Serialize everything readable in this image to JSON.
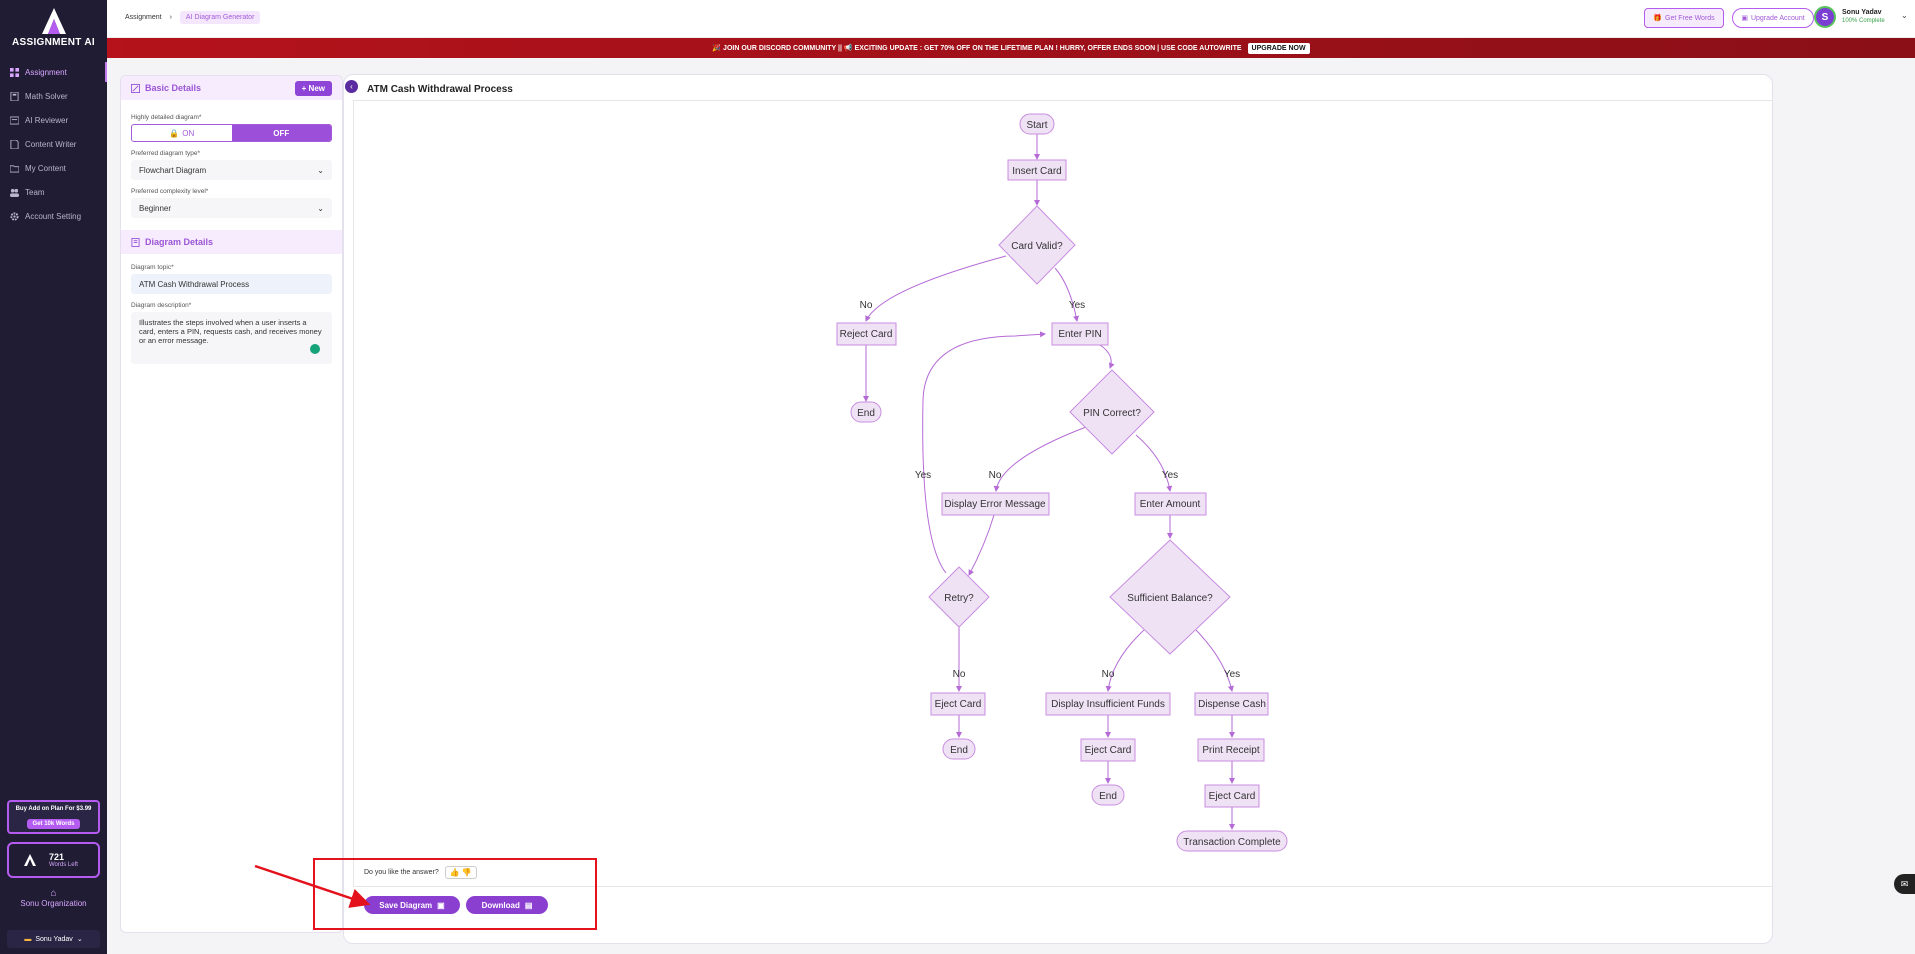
{
  "sidebar": {
    "logo_text": "ASSIGNMENT AI",
    "items": [
      {
        "label": "Assignment",
        "icon": "grid-icon",
        "active": true
      },
      {
        "label": "Math Solver",
        "icon": "calculator-icon",
        "active": false
      },
      {
        "label": "AI Reviewer",
        "icon": "review-icon",
        "active": false
      },
      {
        "label": "Content Writer",
        "icon": "document-icon",
        "active": false
      },
      {
        "label": "My Content",
        "icon": "folder-icon",
        "active": false
      },
      {
        "label": "Team",
        "icon": "team-icon",
        "active": false
      },
      {
        "label": "Account Setting",
        "icon": "gear-icon",
        "active": false
      }
    ],
    "promo_text": "Buy Add on Plan For $3.99",
    "promo_button": "Get 10k Words",
    "words_count": "721",
    "words_label": "Words Left",
    "org_name": "Sonu Organization",
    "footer_user": "Sonu Yadav"
  },
  "topbar": {
    "breadcrumb_root": "Assignment",
    "breadcrumb_current": "AI Diagram Generator",
    "free_words": "Get Free Words",
    "upgrade": "Upgrade Account",
    "avatar_letter": "S",
    "user_name": "Sonu Yadav",
    "user_status": "100% Complete"
  },
  "banner": {
    "text": "🎉 JOIN OUR DISCORD COMMUNITY || 📢 EXCITING UPDATE : GET 70% OFF ON THE LIFETIME PLAN ! HURRY, OFFER ENDS SOON | USE CODE AUTOWRITE",
    "button": "UPGRADE NOW"
  },
  "left_panel": {
    "basic_title": "Basic Details",
    "new_button": "New",
    "detailed_label": "Highly detailed diagram*",
    "on_label": "ON",
    "off_label": "OFF",
    "type_label": "Preferred diagram type*",
    "type_value": "Flowchart Diagram",
    "complexity_label": "Preferred complexity level*",
    "complexity_value": "Beginner",
    "details_title": "Diagram Details",
    "topic_label": "Diagram topic*",
    "topic_value": "ATM Cash Withdrawal Process",
    "desc_label": "Diagram description*",
    "desc_value": "Illustrates the steps involved when a user inserts a card, enters a PIN, requests cash, and receives money or an error message."
  },
  "main": {
    "title": "ATM Cash Withdrawal Process",
    "like_question": "Do you like the answer?",
    "save_button": "Save Diagram",
    "download_button": "Download"
  },
  "diagram": {
    "nodes": {
      "start": "Start",
      "insert": "Insert Card",
      "valid": "Card Valid?",
      "reject": "Reject Card",
      "end1": "End",
      "pin": "Enter PIN",
      "pinok": "PIN Correct?",
      "err": "Display Error Message",
      "amount": "Enter Amount",
      "retry": "Retry?",
      "balance": "Sufficient Balance?",
      "eject1": "Eject Card",
      "end2": "End",
      "insuff": "Display Insufficient Funds",
      "dispense": "Dispense Cash",
      "eject2": "Eject Card",
      "receipt": "Print Receipt",
      "end3": "End",
      "eject3": "Eject Card",
      "complete": "Transaction Complete"
    },
    "edges": {
      "valid_no": "No",
      "valid_yes": "Yes",
      "retry_yes": "Yes",
      "pin_no": "No",
      "pin_yes": "Yes",
      "retry_no": "No",
      "bal_no": "No",
      "bal_yes": "Yes"
    }
  }
}
